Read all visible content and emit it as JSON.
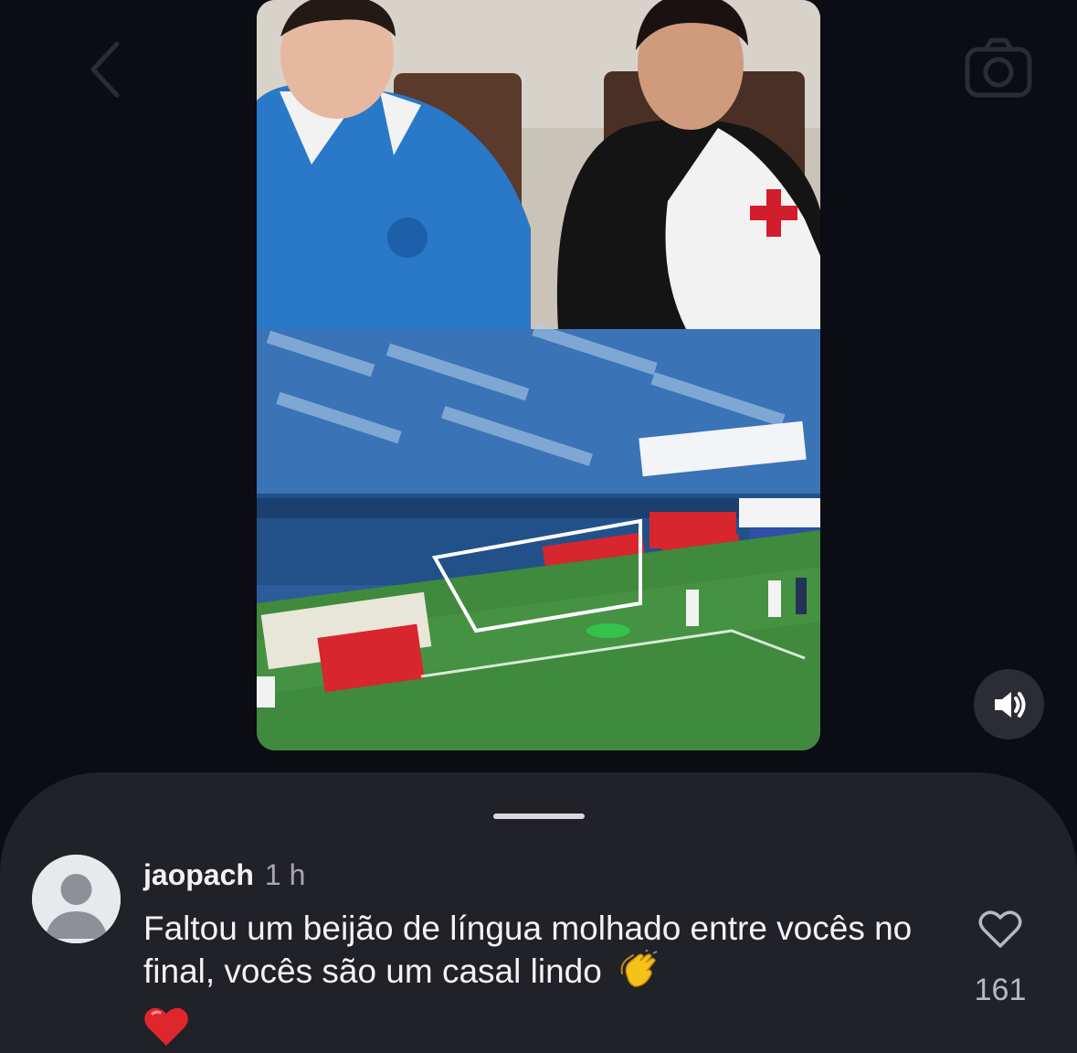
{
  "nav": {
    "back_icon": "chevron-left-icon",
    "camera_icon": "camera-icon"
  },
  "video": {
    "volume_icon": "speaker-on-icon"
  },
  "comment": {
    "username": "jaopach",
    "time": "1 h",
    "text": "Faltou um beijão de língua molhado entre vocês no final, vocês são um casal lindo",
    "emoji_clap": "clapping-hands-emoji",
    "emoji_heart": "red-heart-emoji",
    "like_icon": "heart-outline-icon",
    "like_count": "161"
  },
  "colors": {
    "background": "#0b0c14",
    "sheet": "#212228",
    "heart": "#e0262d"
  }
}
